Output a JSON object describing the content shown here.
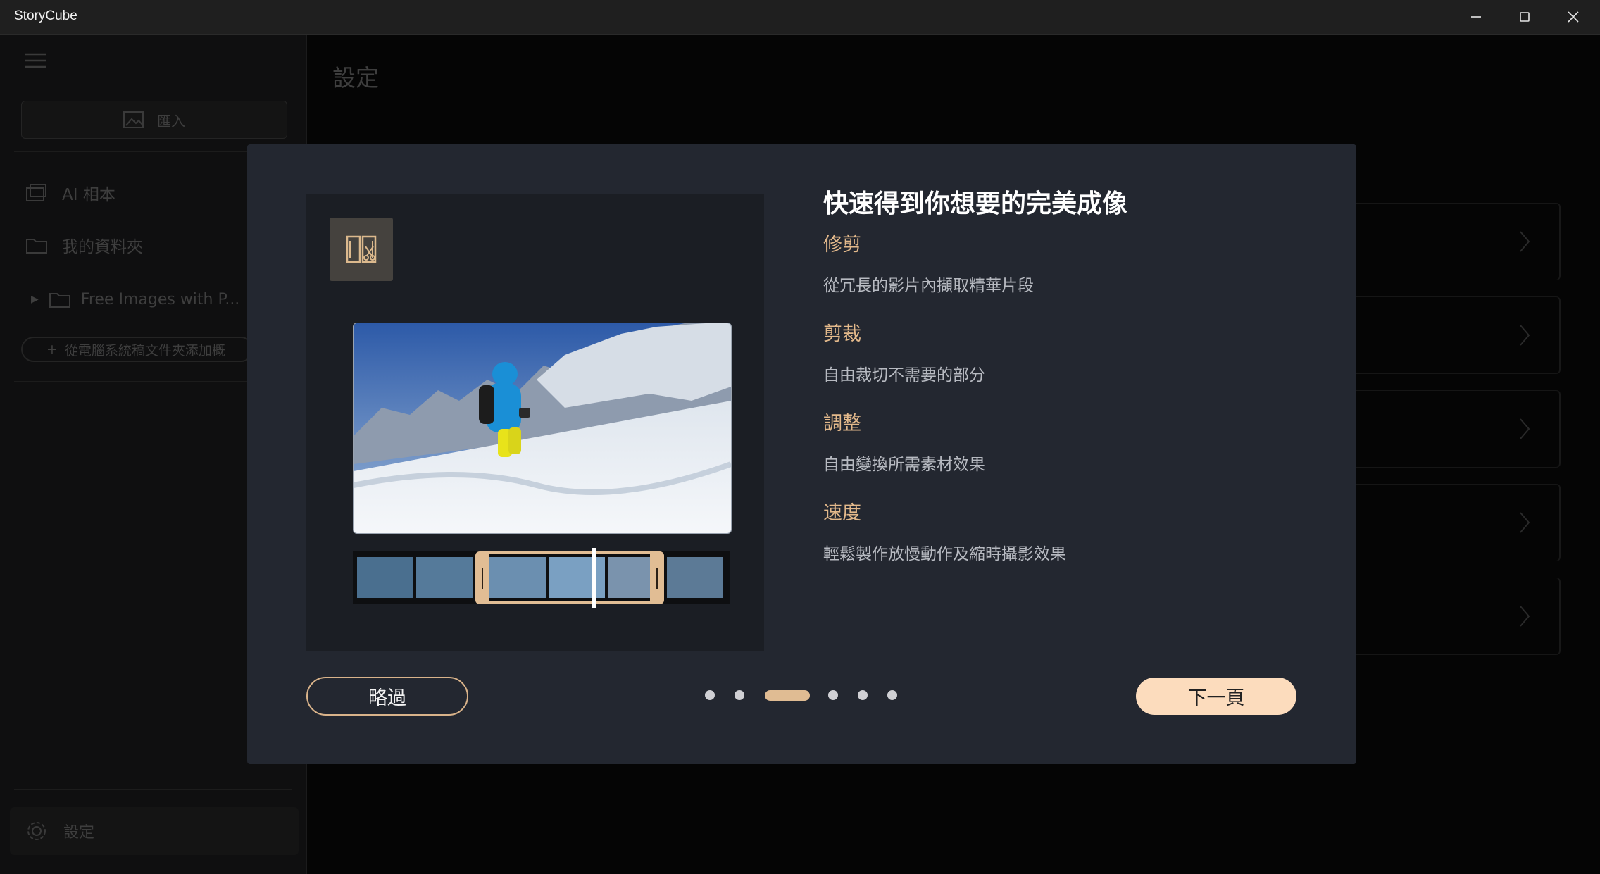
{
  "window": {
    "title": "StoryCube"
  },
  "sidebar": {
    "import_label": "匯入",
    "items": [
      {
        "label": "AI 相本",
        "icon": "ai-album-icon"
      },
      {
        "label": "我的資料夾",
        "icon": "folder-icon"
      }
    ],
    "tree_folder": "Free Images with P...",
    "add_folder_label": "從電腦系統稿文件夾添加概",
    "settings_label": "設定"
  },
  "main": {
    "page_title": "設定"
  },
  "dialog": {
    "heading": "快速得到你想要的完美成像",
    "features": [
      {
        "title": "修剪",
        "desc": "從冗長的影片內擷取精華片段"
      },
      {
        "title": "剪裁",
        "desc": "自由裁切不需要的部分"
      },
      {
        "title": "調整",
        "desc": "自由變換所需素材效果"
      },
      {
        "title": "速度",
        "desc": "輕鬆製作放慢動作及縮時攝影效果"
      }
    ],
    "skip_label": "略過",
    "next_label": "下一頁",
    "pagination": {
      "total": 6,
      "current": 3
    }
  },
  "colors": {
    "accent": "#e1bd94",
    "dialog_bg": "#232730",
    "next_button": "#fcdcbd"
  }
}
